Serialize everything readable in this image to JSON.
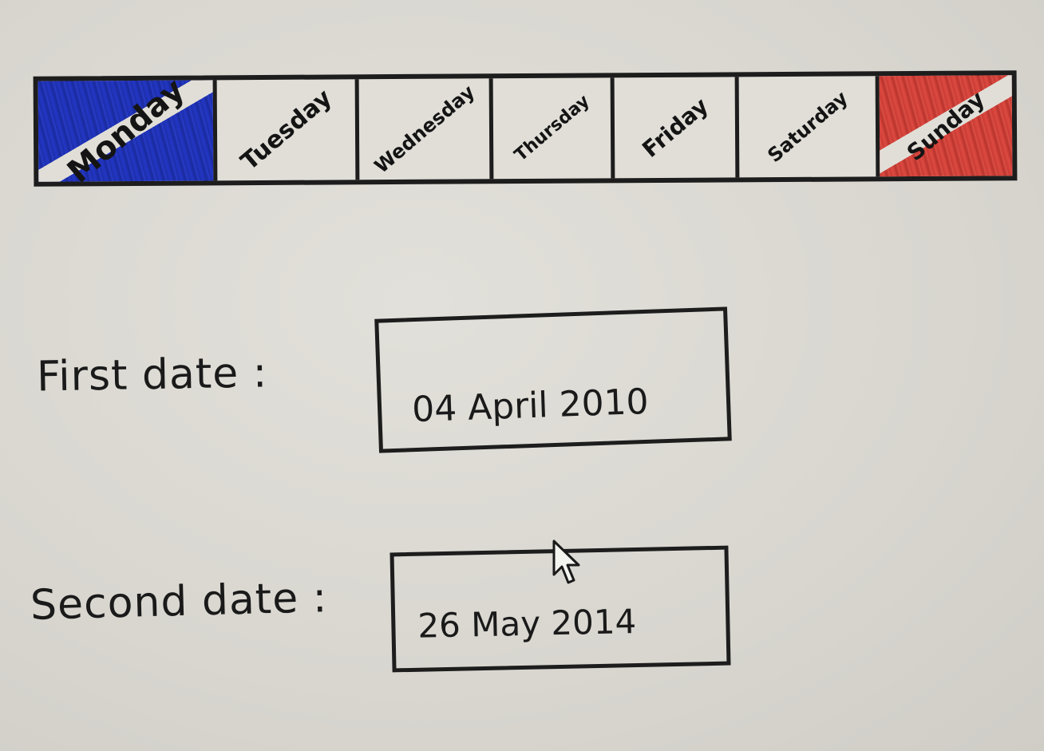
{
  "calendar": {
    "days": [
      {
        "label": "Monday",
        "state": "range-start",
        "color": "#2236c4"
      },
      {
        "label": "Tuesday",
        "state": "default"
      },
      {
        "label": "Wednesday",
        "state": "default"
      },
      {
        "label": "Thursday",
        "state": "default"
      },
      {
        "label": "Friday",
        "state": "default"
      },
      {
        "label": "Saturday",
        "state": "default"
      },
      {
        "label": "Sunday",
        "state": "range-end",
        "color": "#dc4a40"
      }
    ]
  },
  "form": {
    "first_date": {
      "label": "First date :",
      "value": "04 April 2010"
    },
    "second_date": {
      "label": "Second date :",
      "value": "26 May 2014"
    }
  },
  "pointer": {
    "icon": "mouse-pointer-icon"
  }
}
